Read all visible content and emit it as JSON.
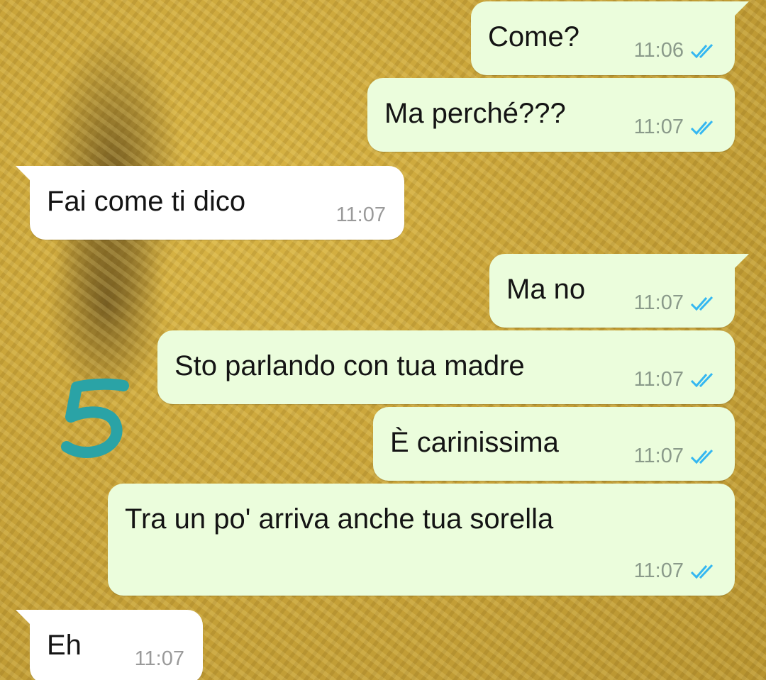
{
  "chat": {
    "messages": [
      {
        "text": "Come?",
        "time": "11:06",
        "direction": "outgoing",
        "status_icon": "double-check-read-icon"
      },
      {
        "text": "Ma perché???",
        "time": "11:07",
        "direction": "outgoing",
        "status_icon": "double-check-read-icon"
      },
      {
        "text": "Fai come ti dico",
        "time": "11:07",
        "direction": "incoming"
      },
      {
        "text": "Ma no",
        "time": "11:07",
        "direction": "outgoing",
        "status_icon": "double-check-read-icon"
      },
      {
        "text": "Sto parlando con tua madre",
        "time": "11:07",
        "direction": "outgoing",
        "status_icon": "double-check-read-icon"
      },
      {
        "text": "È carinissima",
        "time": "11:07",
        "direction": "outgoing",
        "status_icon": "double-check-read-icon"
      },
      {
        "text": "Tra un po' arriva anche tua sorella",
        "time": "11:07",
        "direction": "outgoing",
        "status_icon": "double-check-read-icon"
      },
      {
        "text": "Eh",
        "time": "11:07",
        "direction": "incoming"
      }
    ]
  },
  "annotation": {
    "label": "5",
    "color": "#2aa3a6"
  },
  "colors": {
    "outgoing_bubble": "#ebfddc",
    "incoming_bubble": "#ffffff",
    "read_ticks": "#34b7f1"
  }
}
